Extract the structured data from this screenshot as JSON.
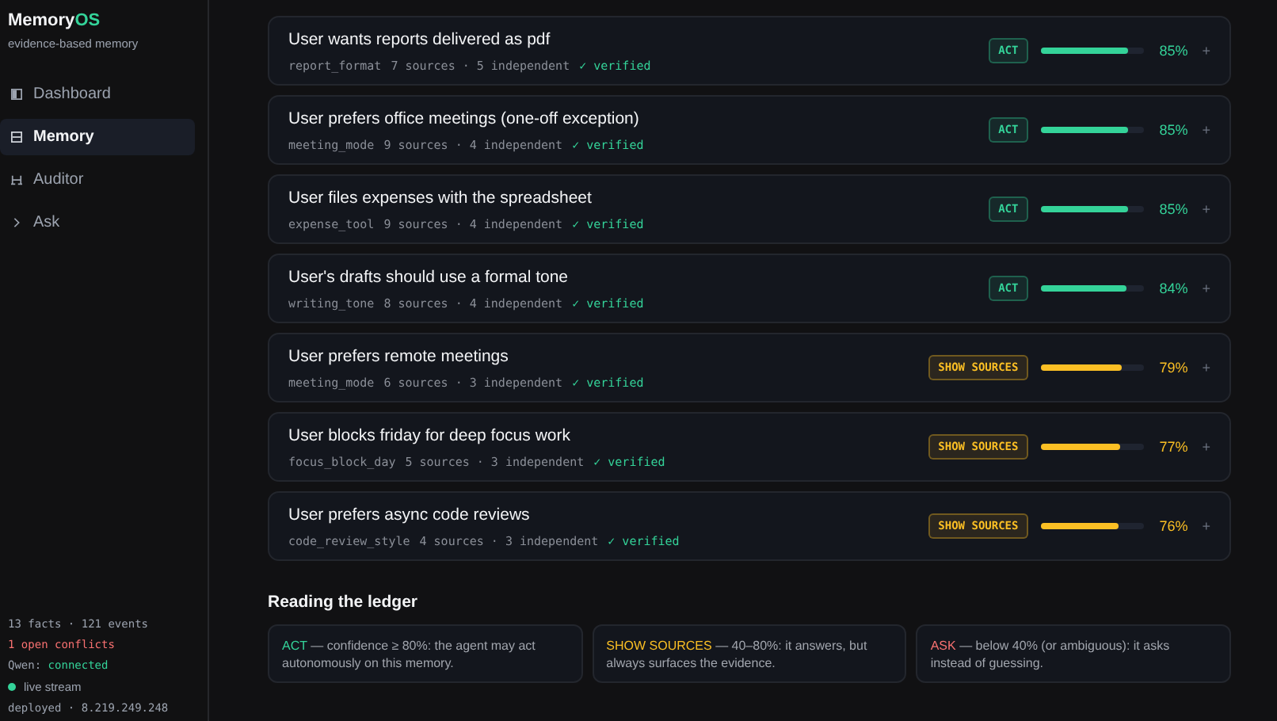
{
  "brand": {
    "name": "Memory",
    "accent": "OS",
    "tagline": "evidence-based memory"
  },
  "nav": [
    {
      "label": "Dashboard",
      "selected": false
    },
    {
      "label": "Memory",
      "selected": true
    },
    {
      "label": "Auditor",
      "selected": false
    },
    {
      "label": "Ask",
      "selected": false
    }
  ],
  "sidebar_footer": {
    "stats": "13 facts · 121 events",
    "conflicts": "1 open conflicts",
    "model_label": "Qwen:",
    "model_status": "connected",
    "stream": "live stream",
    "deployed": "deployed · 8.219.249.248"
  },
  "facts": [
    {
      "title": "User wants reports delivered as pdf",
      "key": "report_format",
      "counts": "7 sources · 5 independent",
      "status": "✓ verified",
      "badge": {
        "kind": "act",
        "label": "ACT"
      },
      "level": 0.85,
      "reading": "85%",
      "action": "+"
    },
    {
      "title": "User prefers office meetings (one-off exception)",
      "key": "meeting_mode",
      "counts": "9 sources · 4 independent",
      "status": "✓ verified",
      "badge": {
        "kind": "act",
        "label": "ACT"
      },
      "level": 0.85,
      "reading": "85%",
      "action": "+"
    },
    {
      "title": "User files expenses with the spreadsheet",
      "key": "expense_tool",
      "counts": "9 sources · 4 independent",
      "status": "✓ verified",
      "badge": {
        "kind": "act",
        "label": "ACT"
      },
      "level": 0.85,
      "reading": "85%",
      "action": "+"
    },
    {
      "title": "User's drafts should use a formal tone",
      "key": "writing_tone",
      "counts": "8 sources · 4 independent",
      "status": "✓ verified",
      "badge": {
        "kind": "act",
        "label": "ACT"
      },
      "level": 0.84,
      "reading": "84%",
      "action": "+"
    },
    {
      "title": "User prefers remote meetings",
      "key": "meeting_mode",
      "counts": "6 sources · 3 independent",
      "status": "✓ verified",
      "badge": {
        "kind": "show",
        "label": "SHOW SOURCES"
      },
      "level": 0.79,
      "reading": "79%",
      "action": "+"
    },
    {
      "title": "User blocks friday for deep focus work",
      "key": "focus_block_day",
      "counts": "5 sources · 3 independent",
      "status": "✓ verified",
      "badge": {
        "kind": "show",
        "label": "SHOW SOURCES"
      },
      "level": 0.77,
      "reading": "77%",
      "action": "+"
    },
    {
      "title": "User prefers async code reviews",
      "key": "code_review_style",
      "counts": "4 sources · 3 independent",
      "status": "✓ verified",
      "badge": {
        "kind": "show",
        "label": "SHOW SOURCES"
      },
      "level": 0.76,
      "reading": "76%",
      "action": "+"
    }
  ],
  "legend": {
    "title": "Reading the ledger",
    "items": [
      {
        "kind": "act",
        "term": "ACT",
        "text": "— confidence ≥ 80%: the agent may act autonomously on this memory."
      },
      {
        "kind": "show",
        "term": "SHOW SOURCES",
        "text": "— 40–80%: it answers, but always surfaces the evidence."
      },
      {
        "kind": "ask",
        "term": "ASK",
        "text": "— below 40% (or ambiguous): it asks instead of guessing."
      }
    ]
  }
}
